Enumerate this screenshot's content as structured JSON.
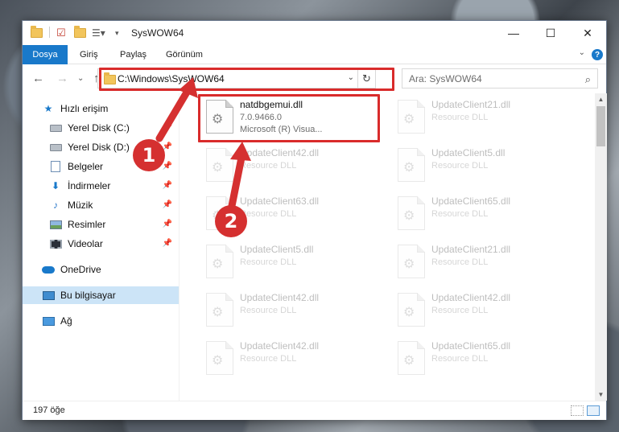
{
  "titlebar": {
    "title": "SysWOW64",
    "minimize_glyph": "—",
    "maximize_glyph": "☐",
    "close_glyph": "✕"
  },
  "ribbon": {
    "tabs": [
      "Dosya",
      "Giriş",
      "Paylaş",
      "Görünüm"
    ],
    "help_glyph": "?",
    "collapse_glyph": "⌄"
  },
  "address_bar": {
    "path": "C:\\Windows\\SysWOW64",
    "dropdown_glyph": "⌄",
    "refresh_glyph": "↻"
  },
  "search": {
    "placeholder": "Ara: SysWOW64",
    "icon": "search-icon"
  },
  "nav": {
    "back_glyph": "←",
    "forward_glyph": "→",
    "recent_glyph": "⌄",
    "up_glyph": "↑"
  },
  "sidebar": {
    "quick_access": "Hızlı erişim",
    "items": [
      {
        "label": "Yerel Disk (C:)",
        "icon": "disk-icon"
      },
      {
        "label": "Yerel Disk (D:)",
        "icon": "disk-icon"
      },
      {
        "label": "Belgeler",
        "icon": "document-icon"
      },
      {
        "label": "İndirmeler",
        "icon": "download-icon"
      },
      {
        "label": "Müzik",
        "icon": "music-icon"
      },
      {
        "label": "Resimler",
        "icon": "picture-icon"
      },
      {
        "label": "Videolar",
        "icon": "video-icon"
      }
    ],
    "onedrive": "OneDrive",
    "this_pc": "Bu bilgisayar",
    "network": "Ağ"
  },
  "files": {
    "focused": {
      "name": "natdbgemui.dll",
      "version": "7.0.9466.0",
      "description": "Microsoft (R) Visua..."
    },
    "background": [
      {
        "name": "UpdateClient21.dll",
        "desc": "Resource DLL"
      },
      {
        "name": "UpdateClient42.dll",
        "desc": "Resource DLL"
      },
      {
        "name": "UpdateClient5.dll",
        "desc": "Resource DLL"
      },
      {
        "name": "UpdateClient63.dll",
        "desc": "Resource DLL"
      },
      {
        "name": "UpdateClient65.dll",
        "desc": "Resource DLL"
      },
      {
        "name": "UpdateClient5.dll",
        "desc": "Resource DLL"
      },
      {
        "name": "UpdateClient21.dll",
        "desc": "Resource DLL"
      },
      {
        "name": "UpdateClient42.dll",
        "desc": "Resource DLL"
      },
      {
        "name": "UpdateClient42.dll",
        "desc": "Resource DLL"
      },
      {
        "name": "UpdateClient42.dll",
        "desc": "Resource DLL"
      },
      {
        "name": "UpdateClient65.dll",
        "desc": "Resource DLL"
      }
    ]
  },
  "status_bar": {
    "item_count": "197 öğe"
  },
  "callouts": {
    "one": "1",
    "two": "2",
    "color": "#d53030"
  },
  "colors": {
    "accent": "#1979ca",
    "selected_bg": "#cce4f7",
    "highlight_box": "#d92b2b"
  }
}
